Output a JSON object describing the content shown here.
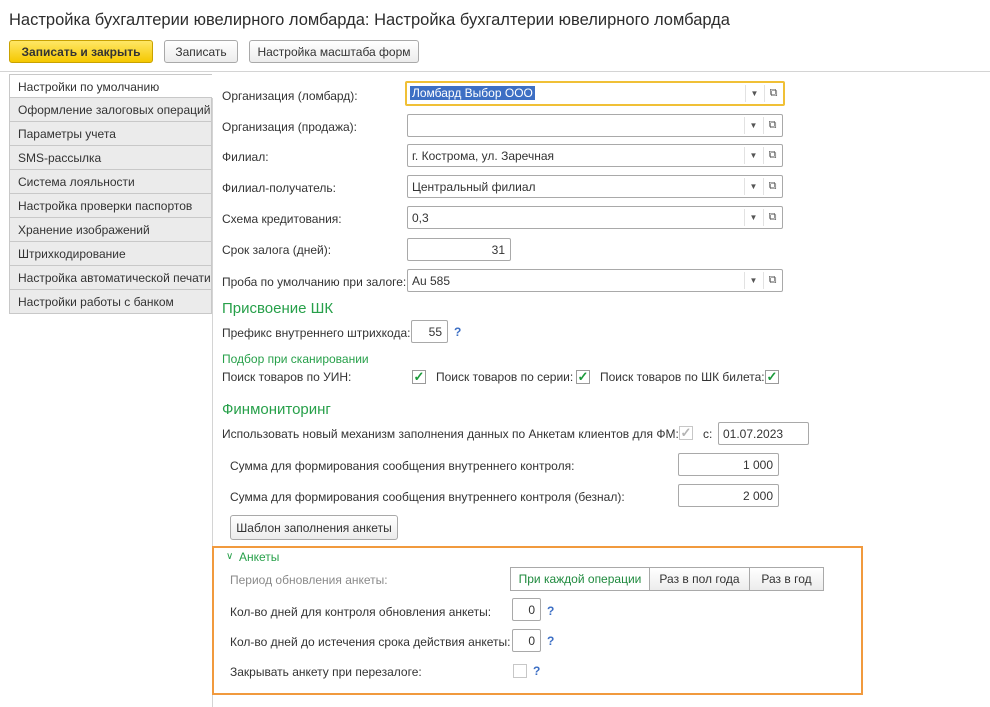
{
  "window": {
    "title": "Настройка бухгалтерии ювелирного ломбарда: Настройка бухгалтерии ювелирного ломбарда"
  },
  "toolbar": {
    "save_close": "Записать и закрыть",
    "save": "Записать",
    "scale": "Настройка масштаба форм"
  },
  "tabs": [
    {
      "label": "Настройки по умолчанию"
    },
    {
      "label": "Оформление залоговых операций"
    },
    {
      "label": "Параметры учета"
    },
    {
      "label": "SMS-рассылка"
    },
    {
      "label": "Система лояльности"
    },
    {
      "label": "Настройка проверки паспортов"
    },
    {
      "label": "Хранение изображений"
    },
    {
      "label": "Штрихкодирование"
    },
    {
      "label": "Настройка автоматической печати"
    },
    {
      "label": "Настройки работы с банком"
    }
  ],
  "form": {
    "org_pawn": {
      "label": "Организация (ломбард):",
      "value": "Ломбард Выбор ООО"
    },
    "org_sale": {
      "label": "Организация (продажа):",
      "value": ""
    },
    "branch": {
      "label": "Филиал:",
      "value": "г. Кострома, ул. Заречная"
    },
    "branch_recv": {
      "label": "Филиал-получатель:",
      "value": "Центральный филиал"
    },
    "credit_scheme": {
      "label": "Схема кредитования:",
      "value": "0,3"
    },
    "pledge_term": {
      "label": "Срок залога (дней):",
      "value": "31"
    },
    "default_probe": {
      "label": "Проба по умолчанию при залоге:",
      "value": "Au 585"
    }
  },
  "barcode": {
    "section": "Присвоение ШК",
    "prefix_label": "Префикс внутреннего штрихкода:",
    "prefix_value": "55",
    "help": "?",
    "scan_section": "Подбор при сканировании",
    "search_uin": "Поиск товаров по УИН:",
    "search_series": "Поиск товаров по серии:",
    "search_ticket": "Поиск товаров по ШК билета:",
    "check": "✓"
  },
  "finmon": {
    "section": "Финмониторинг",
    "new_mech_label": "Использовать новый механизм заполнения данных по Анкетам клиентов для ФМ:",
    "from_label": "с:",
    "from_date": "01.07.2023",
    "sum_label": "Сумма для формирования сообщения внутреннего контроля:",
    "sum_value": "1 000",
    "sum_cashless_label": "Сумма для формирования сообщения внутреннего контроля (безнал):",
    "sum_cashless_value": "2 000",
    "template_button": "Шаблон заполнения анкеты"
  },
  "questionnaires": {
    "section": "Анкеты",
    "period_label": "Период обновления анкеты:",
    "options": [
      "При каждой операции",
      "Раз в пол года",
      "Раз в год"
    ],
    "control_days_label": "Кол-во дней для контроля обновления анкеты:",
    "control_days_value": "0",
    "expire_days_label": "Кол-во дней до истечения срока действия анкеты:",
    "expire_days_value": "0",
    "close_label": "Закрывать анкету при перезалоге:",
    "help": "?"
  },
  "icons": {
    "dropdown": "▼",
    "open": "⧉",
    "chevron": "∨"
  },
  "colors": {
    "accent_green": "#27a04a",
    "primary_yellow": "#f5c800",
    "highlight_orange": "#f19a3e",
    "selection_blue": "#3d6fc4"
  }
}
